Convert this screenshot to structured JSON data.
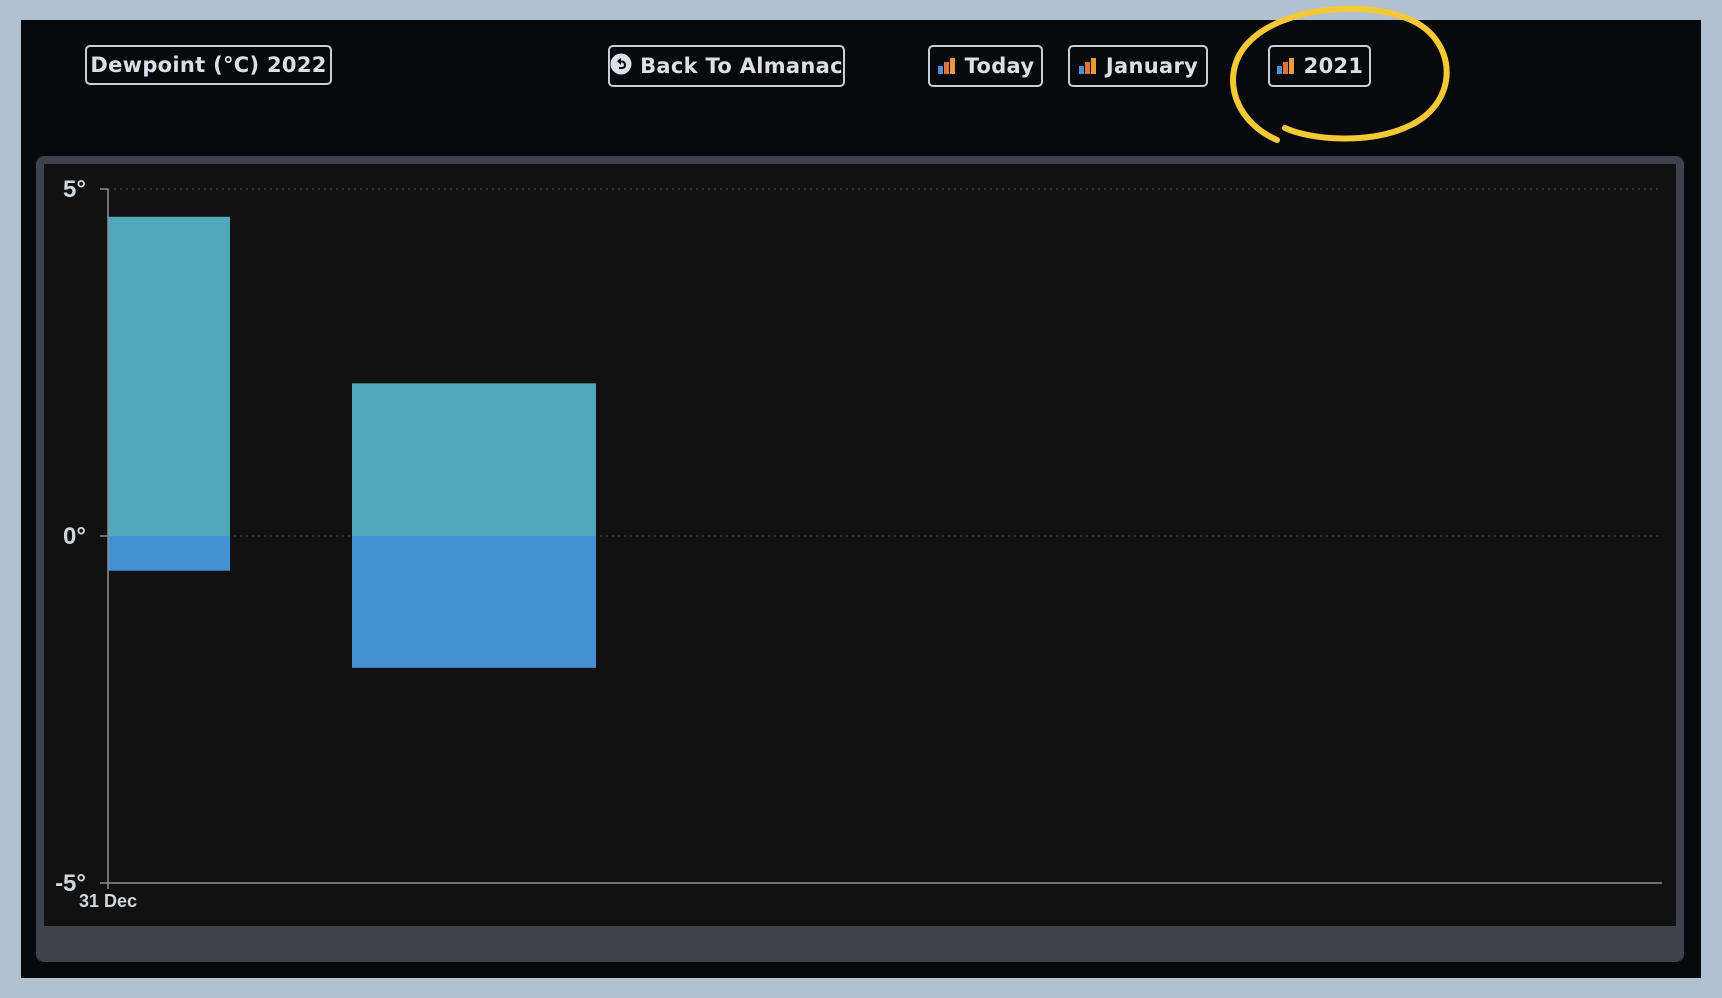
{
  "header": {
    "title": "Dewpoint (°C) 2022",
    "back_label": "Back To Almanac",
    "today_label": "Today",
    "month_label": "January",
    "year_label": "2021"
  },
  "icons": {
    "back": "undo-icon",
    "chart": "bar-chart-icon"
  },
  "annotation": {
    "circled_element": "2021",
    "color": "#f5c935"
  },
  "colors": {
    "positive": "#4fa9ba",
    "negative": "#4590d3",
    "plot_bg": "#111111",
    "frame": "#3c434d",
    "accent_border": "#c5cfda"
  },
  "chart_data": {
    "type": "bar",
    "title": "",
    "ylim": [
      -5,
      5
    ],
    "yticks": [
      5,
      0,
      -5
    ],
    "ytick_labels": [
      "5°",
      "0°",
      "-5°"
    ],
    "xtick_labels": [
      "31 Dec"
    ],
    "gridlines": "dotted at 5 and 0",
    "bars": [
      {
        "slot": 0,
        "top": 4.6,
        "bottom": -0.5
      },
      {
        "slot": 2,
        "top": 2.2,
        "bottom": -1.9
      }
    ]
  }
}
